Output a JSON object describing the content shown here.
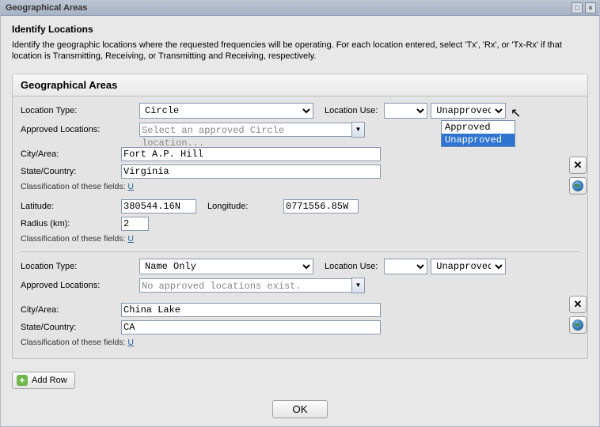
{
  "window": {
    "title": "Geographical Areas"
  },
  "section": {
    "heading": "Identify Locations",
    "description": "Identify the geographic locations where the requested frequencies will be operating. For each location entered, select 'Tx', 'Rx', or 'Tx-Rx' if that location is Transmitting, Receiving, or Transmitting and Receiving, respectively."
  },
  "panel": {
    "title": "Geographical Areas"
  },
  "labels": {
    "location_type": "Location Type:",
    "location_use": "Location Use:",
    "approved_locations": "Approved Locations:",
    "city_area": "City/Area:",
    "state_country": "State/Country:",
    "latitude": "Latitude:",
    "longitude": "Longitude:",
    "radius": "Radius (km):",
    "classification_prefix": "Classification of these fields: ",
    "classification_value": "U"
  },
  "loc1": {
    "location_type": "Circle",
    "location_use": "",
    "approval": "Unapproved",
    "approved_placeholder": "Select an approved Circle location...",
    "city": "Fort A.P. Hill",
    "state": "Virginia",
    "latitude": "380544.16N",
    "longitude": "0771556.85W",
    "radius": "2"
  },
  "loc2": {
    "location_type": "Name Only",
    "location_use": "",
    "approval": "Unapproved",
    "approved_placeholder": "No approved locations exist.",
    "city": "China Lake",
    "state": "CA"
  },
  "approval_options": [
    "Approved",
    "Unapproved"
  ],
  "buttons": {
    "add_row": "Add Row",
    "ok": "OK"
  }
}
